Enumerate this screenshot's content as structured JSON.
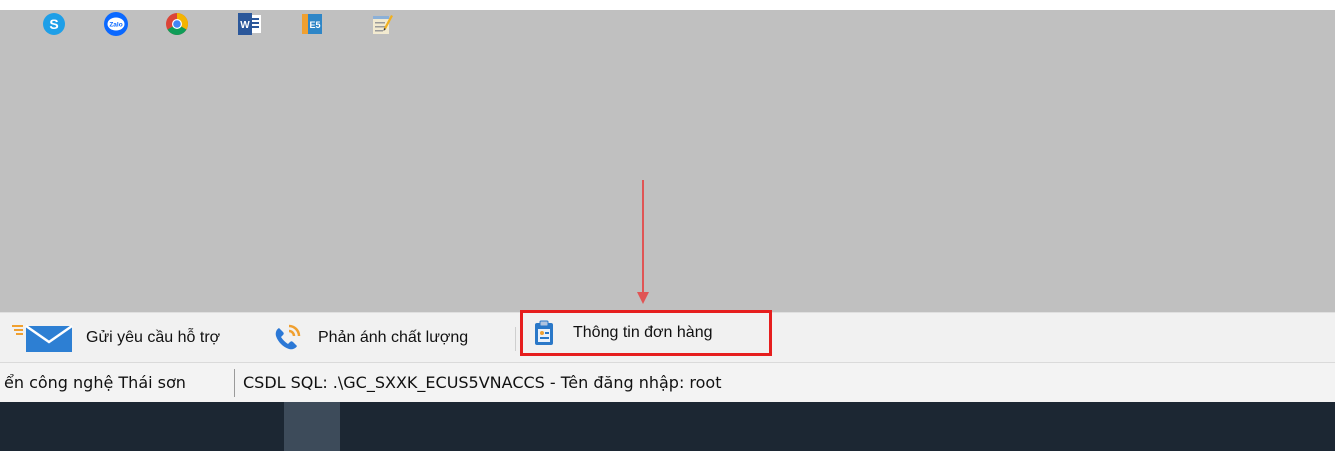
{
  "action_bar": {
    "support_label": "Gửi yêu cầu hỗ trợ",
    "feedback_label": "Phản ánh chất lượng",
    "order_info_label": "Thông tin đơn hàng"
  },
  "status_bar": {
    "company_text": "ển công nghệ Thái sơn",
    "db_info_text": "CSDL SQL: .\\GC_SXXK_ECUS5VNACCS - Tên đăng nhập: root"
  },
  "taskbar": {
    "icons": [
      "skype-icon",
      "zalo-icon",
      "chrome-icon",
      "word-icon",
      "ecus5-icon",
      "notepad-icon"
    ],
    "zalo_text": "Zalo",
    "word_text": "W",
    "ecus_text": "E5"
  },
  "colors": {
    "highlight_border": "#e61e1e",
    "workspace": "#c0c0c0",
    "taskbar": "#1c2733",
    "envelope": "#2d7fd3"
  }
}
